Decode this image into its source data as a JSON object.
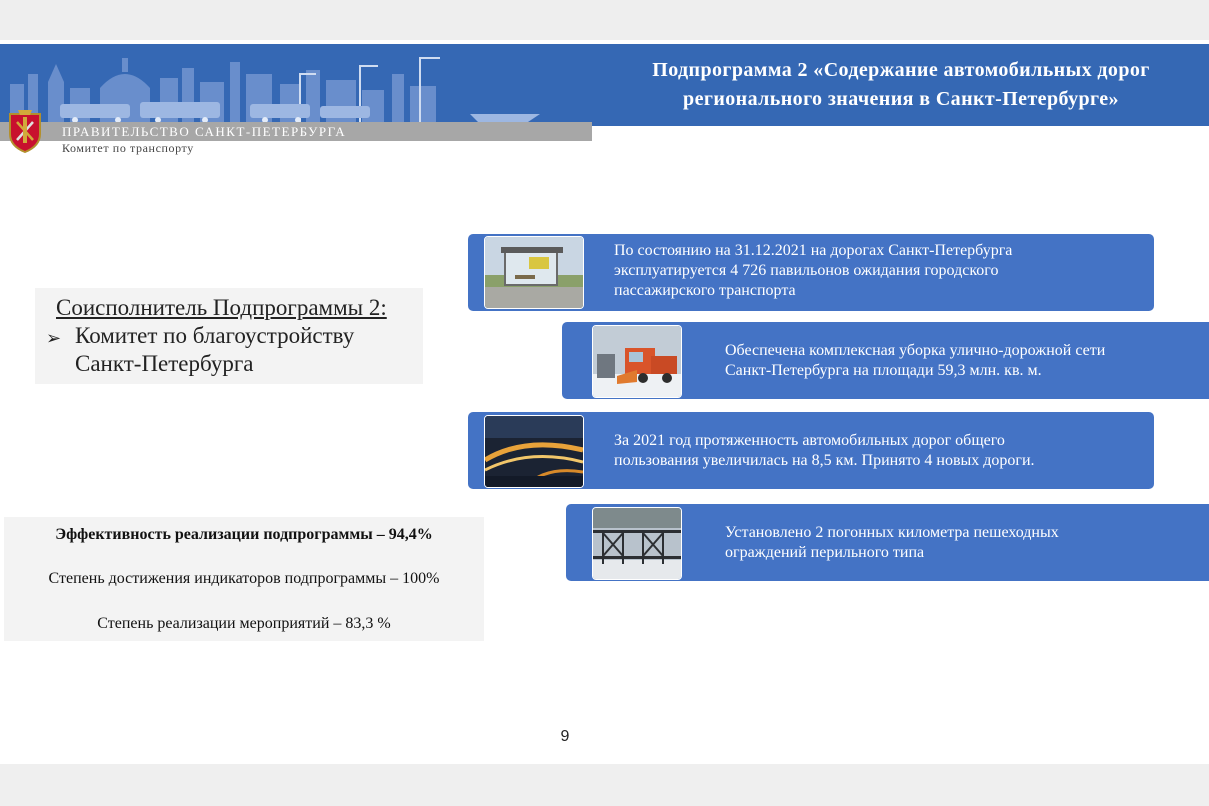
{
  "header": {
    "title_line1": "Подпрограмма 2 «Содержание автомобильных дорог",
    "title_line2": "регионального значения в Санкт-Петербурге»",
    "org_name": "ПРАВИТЕЛЬСТВО САНКТ-ПЕТЕРБУРГА",
    "org_dept": "Комитет по транспорту",
    "emblem_icon": "coat-of-arms-icon"
  },
  "coexecutor": {
    "title": "Соисполнитель Подпрограммы 2:",
    "bullet": "➢",
    "item_line1": "Комитет по благоустройству",
    "item_line2": "Санкт-Петербурга"
  },
  "efficiency": {
    "line1": "Эффективность реализации подпрограммы – 94,4%",
    "line2": "Степень достижения индикаторов подпрограммы – 100%",
    "line3": "Степень реализации мероприятий – 83,3 %"
  },
  "cards": [
    {
      "photo_icon": "bus-stop-pavilion-photo",
      "line1": "По состоянию на 31.12.2021 на дорогах Санкт-Петербурга",
      "line2": "эксплуатируется 4 726 павильонов ожидания городского",
      "line3": "пассажирского транспорта"
    },
    {
      "photo_icon": "snow-plow-truck-photo",
      "line1": "Обеспечена комплексная уборка улично-дорожной сети",
      "line2": "Санкт-Петербурга на площади 59,3 млн. кв. м."
    },
    {
      "photo_icon": "night-highway-photo",
      "line1": "За 2021 год протяженность автомобильных дорог общего",
      "line2": "пользования увеличилась на 8,5 км. Принято 4 новых дороги."
    },
    {
      "photo_icon": "pedestrian-railing-photo",
      "line1": "Установлено 2 погонных километра пешеходных",
      "line2": "ограждений перильного типа"
    }
  ],
  "page_number": "9",
  "colors": {
    "header_blue": "#3568b4",
    "card_blue": "#4473c5",
    "org_band_gray": "#a7a7a7"
  }
}
